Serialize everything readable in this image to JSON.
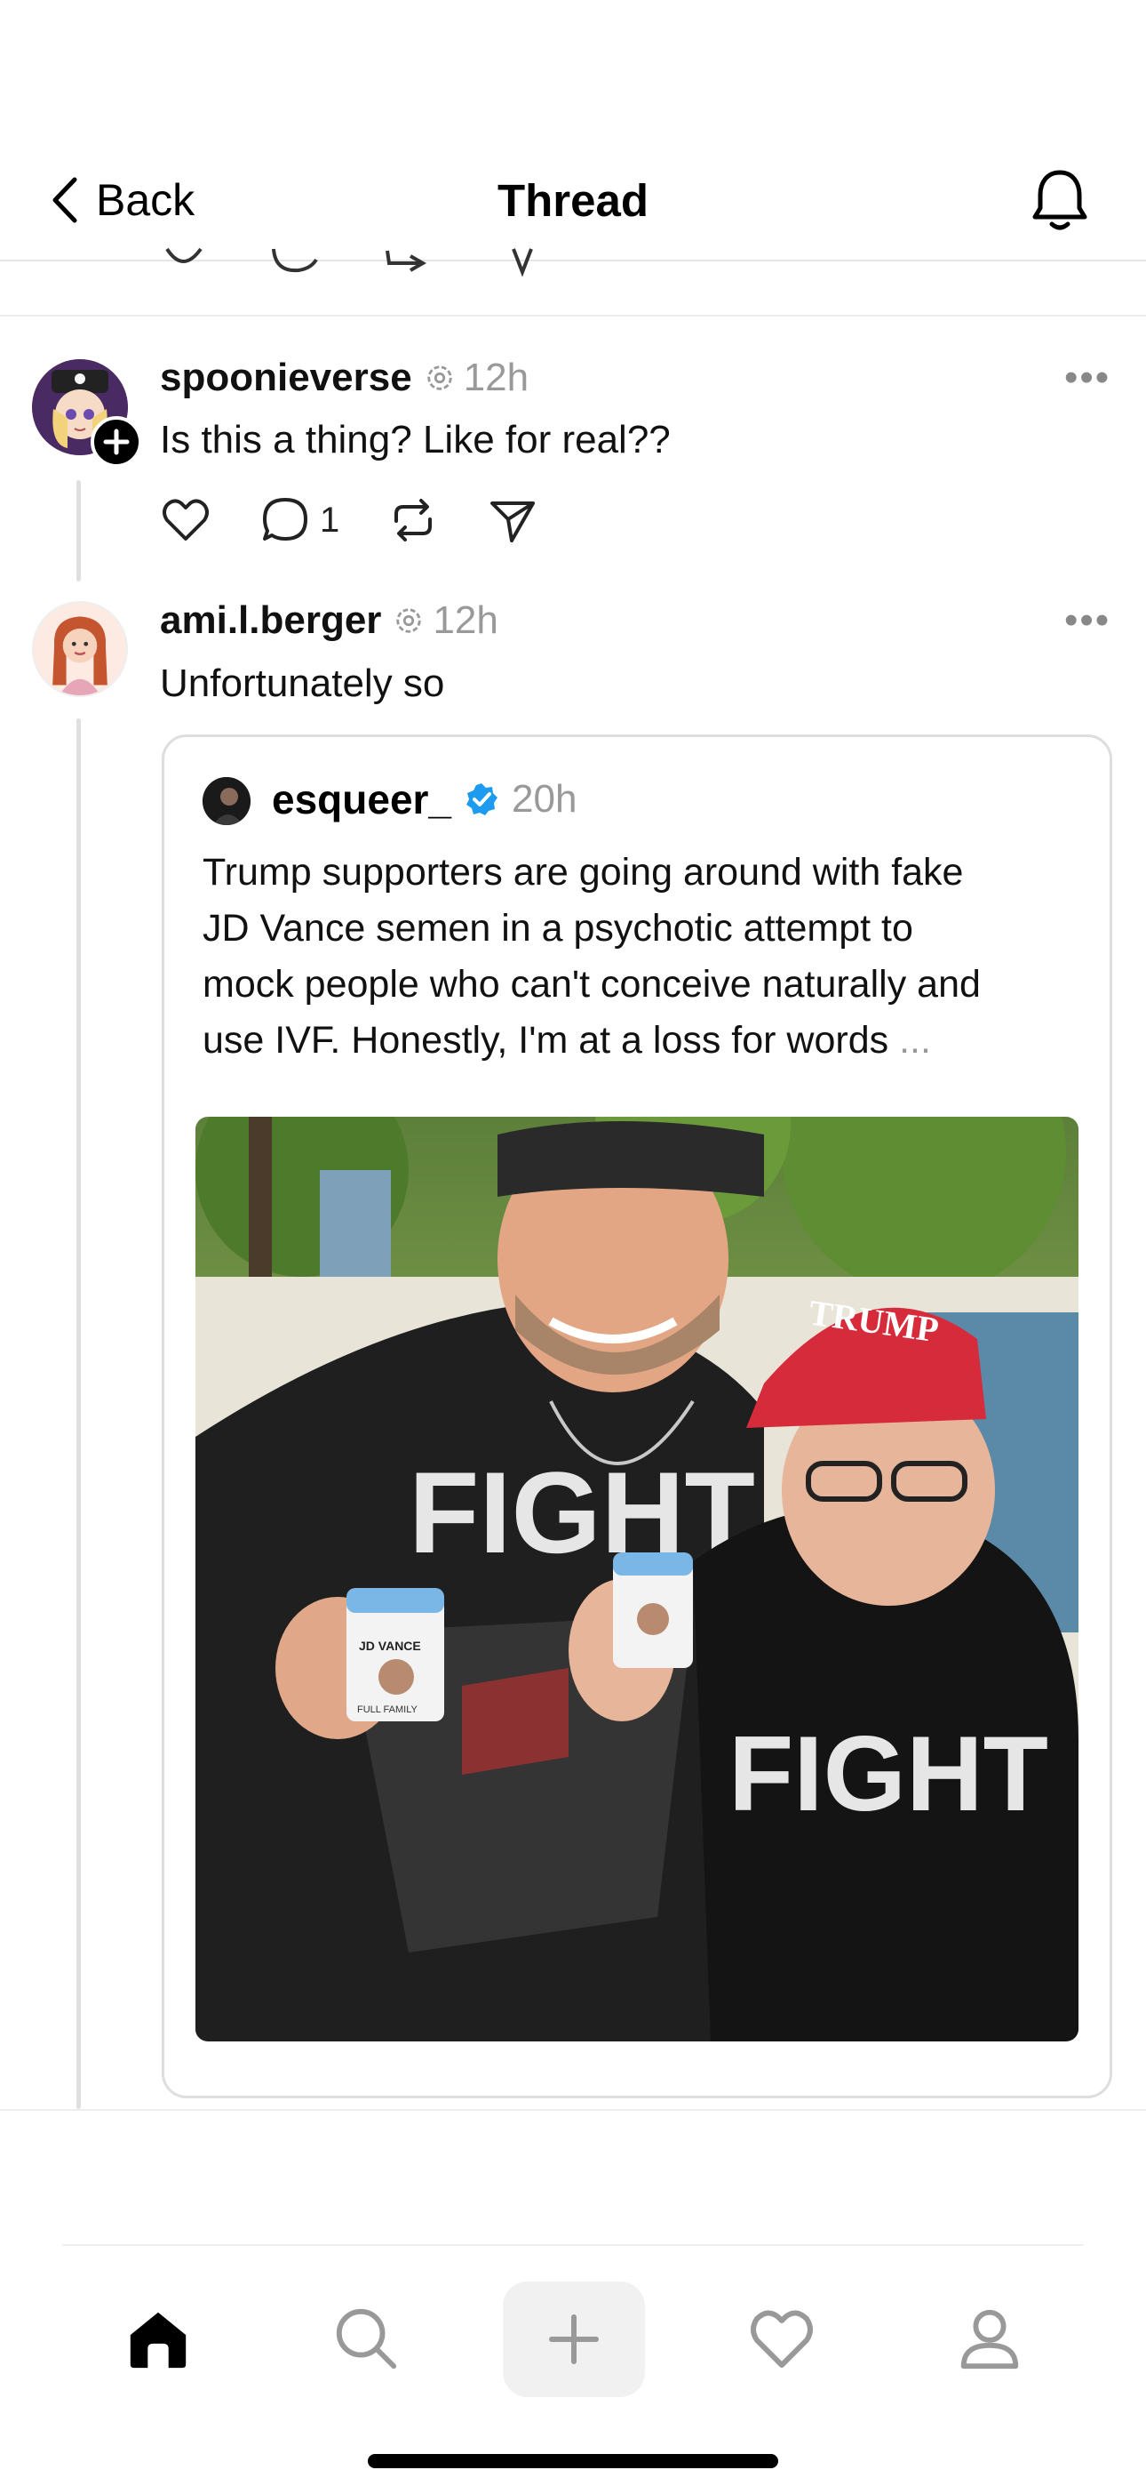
{
  "header": {
    "back_label": "Back",
    "title": "Thread",
    "back_icon": "chevron-left-icon",
    "bell_icon": "bell-icon"
  },
  "posts": [
    {
      "username": "spoonieverse",
      "time": "12h",
      "text": "Is this a thing? Like for real??",
      "reply_count": "1",
      "more": "•••"
    },
    {
      "username": "ami.l.berger",
      "time": "12h",
      "text": "Unfortunately so",
      "more": "•••"
    }
  ],
  "quote": {
    "username": "esqueer_",
    "time": "20h",
    "text_lines": [
      "Trump supporters are going around with fake",
      "JD Vance semen in a psychotic attempt to",
      "mock people who can't conceive naturally and",
      "use IVF. Honestly, I'm at a loss for words"
    ],
    "ellipsis": "...",
    "image_text": {
      "cap": "TRUMP",
      "shirt_left": "FIGHT",
      "shirt_right": "FIGHT",
      "cup_label": "JD VANCE",
      "cup_sub": "FULL FAMILY"
    }
  },
  "nav": {
    "items": [
      "home-icon",
      "search-icon",
      "compose-icon",
      "heart-icon",
      "profile-icon"
    ]
  },
  "colors": {
    "verified": "#1d9bf0",
    "text": "#111111",
    "muted": "#999999",
    "border": "#dedede",
    "cap_red": "#d62b3a"
  }
}
